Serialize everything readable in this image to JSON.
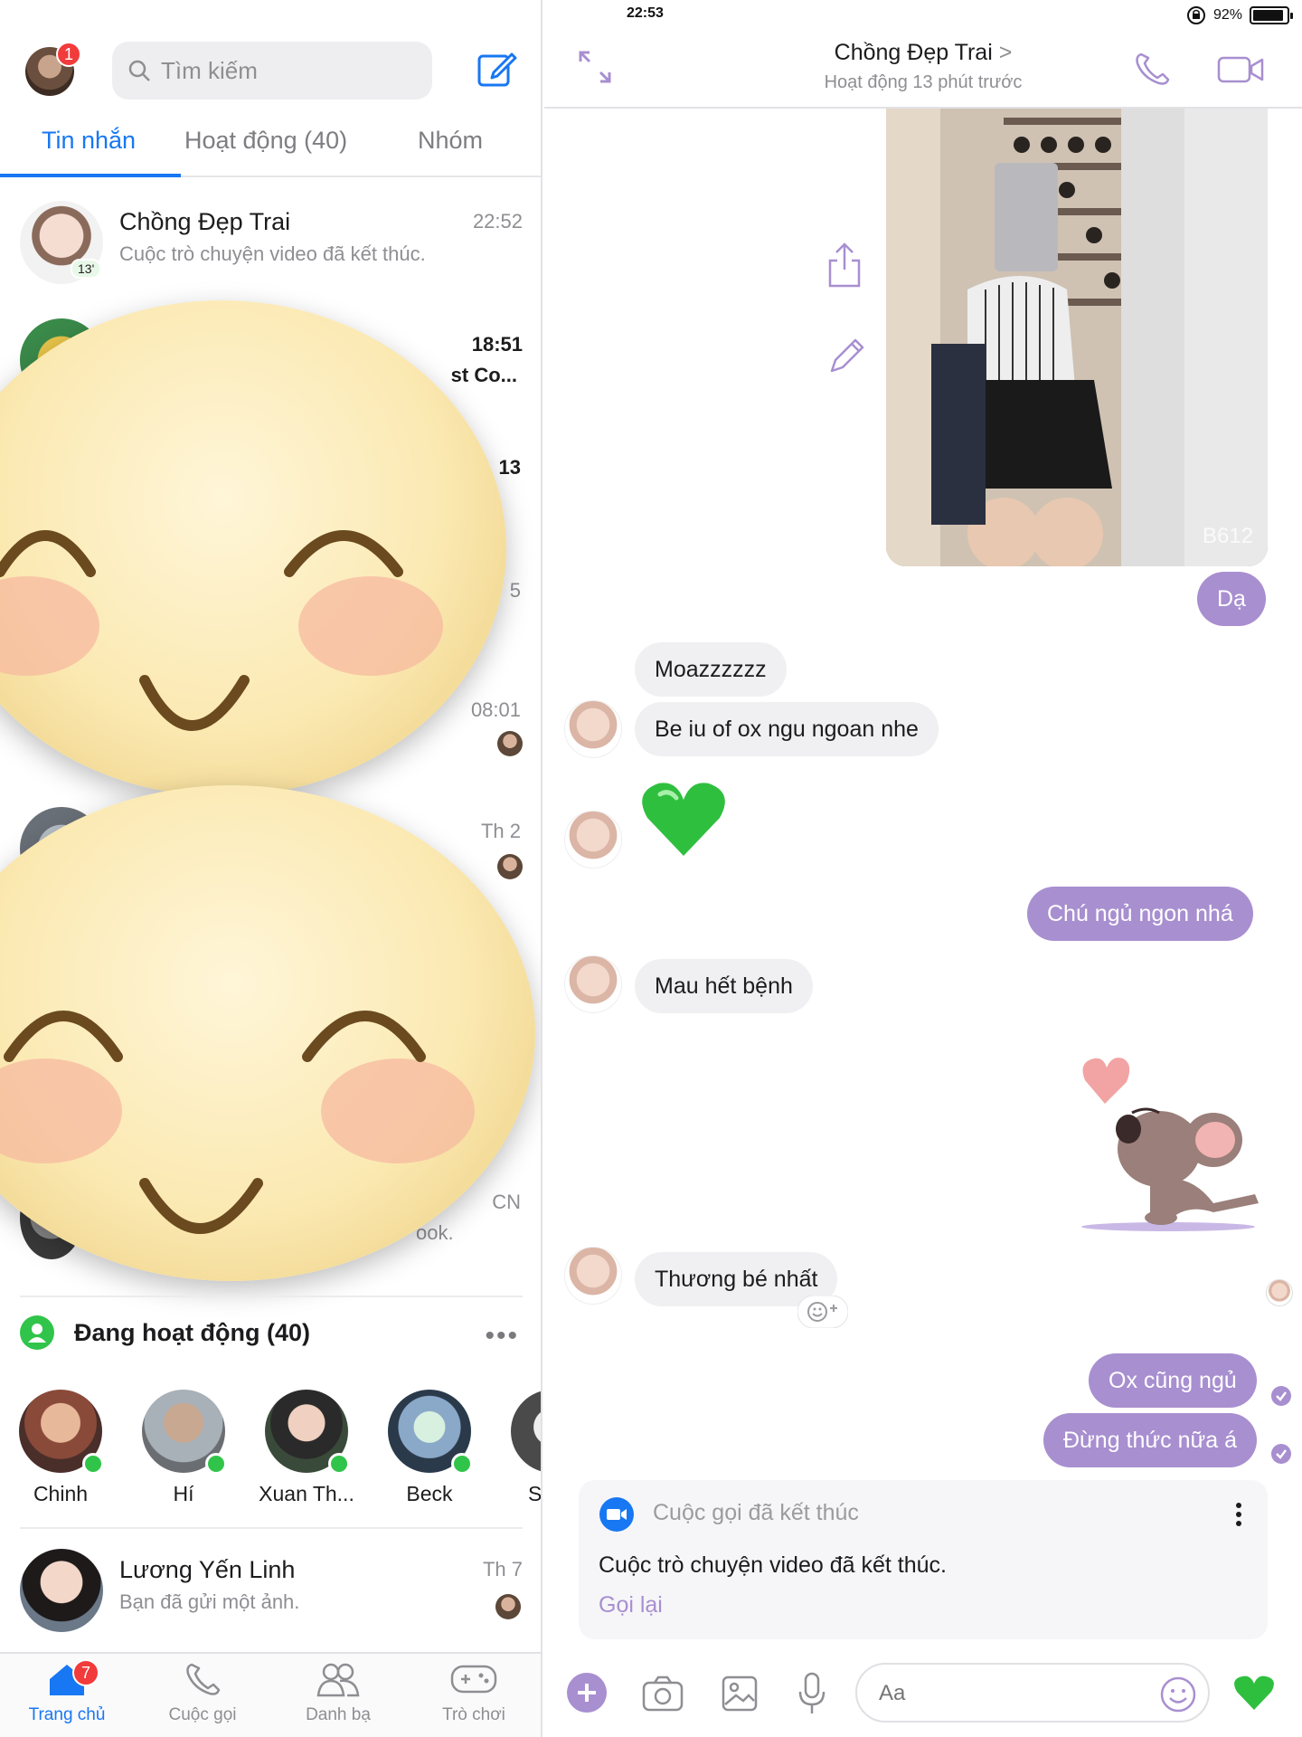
{
  "status_bar": {
    "device": "iPad",
    "time": "22:53",
    "battery": "92%",
    "battery_level": 0.92
  },
  "left": {
    "me_badge": "1",
    "search_placeholder": "Tìm kiếm",
    "tabs": [
      {
        "label": "Tin nhắn",
        "active": true
      },
      {
        "label": "Hoạt động (40)",
        "active": false
      },
      {
        "label": "Nhóm",
        "active": false
      }
    ],
    "conversations": [
      {
        "name": "Chồng Đẹp Trai",
        "preview": "Cuộc trò chuyện video đã kết thúc.",
        "time": "22:52",
        "badge": "13'"
      }
    ],
    "partial_rows": [
      {
        "time": "18:51",
        "preview": "st Co..."
      },
      {
        "time": "13"
      },
      {
        "time": "5"
      },
      {
        "time": "08:01"
      },
      {
        "time": "Th 2"
      },
      {
        "time": "CN",
        "preview": "ook."
      }
    ],
    "active_section": {
      "title": "Đang hoạt động (40)",
      "more": "•••"
    },
    "active_friends": [
      {
        "name": "Chinh"
      },
      {
        "name": "Hí"
      },
      {
        "name": "Xuan Th..."
      },
      {
        "name": "Beck"
      },
      {
        "name": "S"
      }
    ],
    "last_conversation": {
      "name": "Lương Yến Linh",
      "preview": "Bạn đã gửi một ảnh.",
      "time": "Th 7"
    },
    "bottom_nav": [
      {
        "label": "Trang chủ",
        "active": true,
        "badge": "7"
      },
      {
        "label": "Cuộc gọi",
        "active": false
      },
      {
        "label": "Danh bạ",
        "active": false
      },
      {
        "label": "Trò chơi",
        "active": false
      }
    ]
  },
  "chat": {
    "title": "Chồng Đẹp Trai",
    "chevron": ">",
    "subtitle": "Hoạt động 13 phút trước",
    "photo_watermark": "B612",
    "messages": [
      {
        "dir": "out",
        "text": "Dạ"
      },
      {
        "dir": "in",
        "text": "Moazzzzzz"
      },
      {
        "dir": "in",
        "text": "Be iu of ox ngu ngoan nhe"
      },
      {
        "dir": "in",
        "emoji": "green-heart"
      },
      {
        "dir": "out",
        "text": "Chú ngủ ngon nhá"
      },
      {
        "dir": "in",
        "text": "Mau hết bệnh"
      },
      {
        "dir": "out",
        "sticker": "koala-heart-sticker"
      },
      {
        "dir": "in",
        "text": "Thương bé nhất"
      },
      {
        "dir": "out",
        "text": "Ox cũng ngủ"
      },
      {
        "dir": "out",
        "text": "Đừng thức nữa á"
      }
    ],
    "call_card": {
      "title": "Cuộc gọi đã kết thúc",
      "body": "Cuộc trò chuyện video đã kết thúc.",
      "action": "Gọi lại"
    },
    "composer_placeholder": "Aa"
  },
  "colors": {
    "messenger_blue": "#1877f2",
    "bubble_out": "#a88fd0",
    "online": "#31c44a",
    "badge_red": "#f23b3b"
  }
}
